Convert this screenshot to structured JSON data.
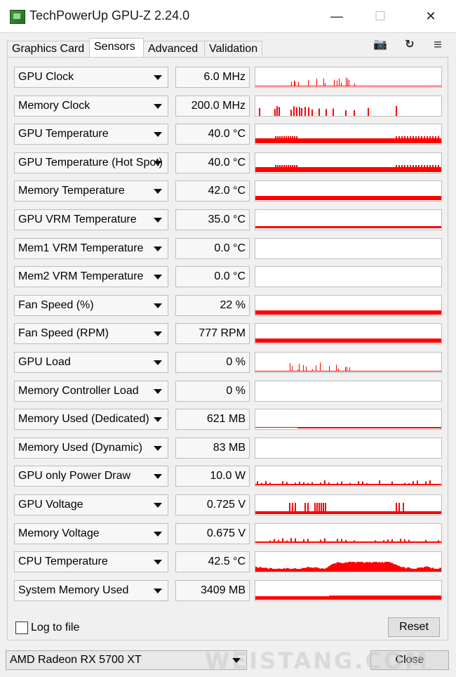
{
  "window": {
    "title": "TechPowerUp GPU-Z 2.24.0",
    "minimize": "—",
    "maximize": "☐",
    "close": "✕"
  },
  "tabs": [
    {
      "label": "Graphics Card"
    },
    {
      "label": "Sensors",
      "active": true
    },
    {
      "label": "Advanced"
    },
    {
      "label": "Validation"
    }
  ],
  "toolbar": {
    "camera": "📷",
    "refresh": "↻",
    "menu": "≡"
  },
  "graph_color": "#ff0000",
  "sensors": [
    {
      "name": "GPU Clock",
      "value": "6.0 MHz",
      "graph": "sparse"
    },
    {
      "name": "Memory Clock",
      "value": "200.0 MHz",
      "graph": "spikes"
    },
    {
      "name": "GPU Temperature",
      "value": "40.0 °C",
      "graph": "high"
    },
    {
      "name": "GPU Temperature (Hot Spot)",
      "value": "40.0 °C",
      "graph": "high"
    },
    {
      "name": "Memory Temperature",
      "value": "42.0 °C",
      "graph": "band"
    },
    {
      "name": "GPU VRM Temperature",
      "value": "35.0 °C",
      "graph": "line"
    },
    {
      "name": "Mem1 VRM Temperature",
      "value": "0.0 °C",
      "graph": "empty"
    },
    {
      "name": "Mem2 VRM Temperature",
      "value": "0.0 °C",
      "graph": "empty"
    },
    {
      "name": "Fan Speed (%)",
      "value": "22 %",
      "graph": "band"
    },
    {
      "name": "Fan Speed (RPM)",
      "value": "777 RPM",
      "graph": "band"
    },
    {
      "name": "GPU Load",
      "value": "0 %",
      "graph": "sparse"
    },
    {
      "name": "Memory Controller Load",
      "value": "0 %",
      "graph": "empty"
    },
    {
      "name": "Memory Used (Dedicated)",
      "value": "621 MB",
      "graph": "thin"
    },
    {
      "name": "Memory Used (Dynamic)",
      "value": "83 MB",
      "graph": "empty"
    },
    {
      "name": "GPU only Power Draw",
      "value": "10.0 W",
      "graph": "noise"
    },
    {
      "name": "GPU Voltage",
      "value": "0.725 V",
      "graph": "voltage"
    },
    {
      "name": "Memory Voltage",
      "value": "0.675 V",
      "graph": "noise"
    },
    {
      "name": "CPU Temperature",
      "value": "42.5 °C",
      "graph": "cpu"
    },
    {
      "name": "System Memory Used",
      "value": "3409 MB",
      "graph": "step"
    }
  ],
  "log_to_file": {
    "label": "Log to file",
    "checked": false
  },
  "reset_label": "Reset",
  "gpu_select": {
    "value": "AMD Radeon RX 5700 XT"
  },
  "close_label": "Close",
  "watermark": "WEISTANG.COM"
}
